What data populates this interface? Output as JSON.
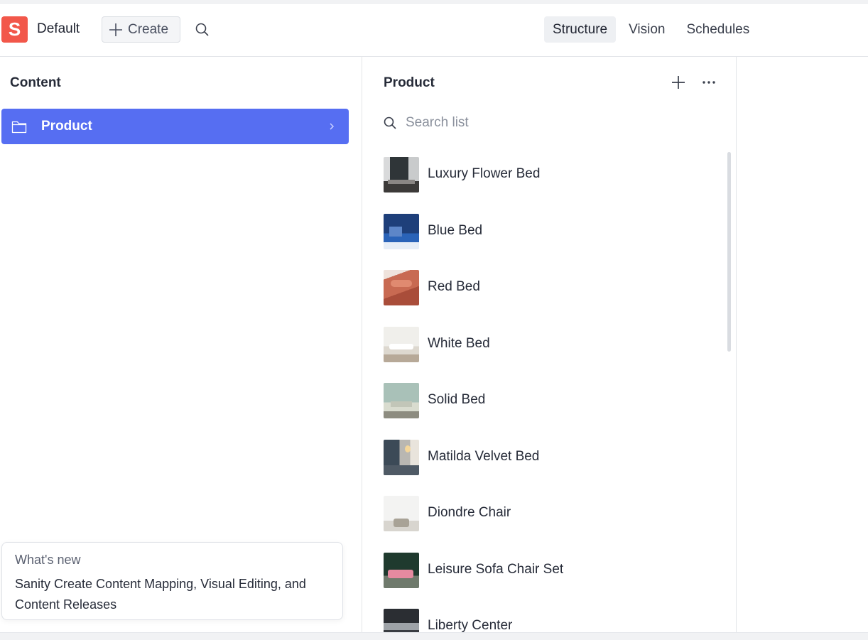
{
  "app": {
    "logo_letter": "S",
    "workspace": "Default",
    "create_label": "Create",
    "tools": [
      {
        "label": "Structure",
        "active": true
      },
      {
        "label": "Vision",
        "active": false
      },
      {
        "label": "Schedules",
        "active": false
      }
    ]
  },
  "content_pane": {
    "title": "Content",
    "items": [
      {
        "label": "Product",
        "icon": "folder-icon",
        "selected": true
      }
    ]
  },
  "whats_new": {
    "kicker": "What's new",
    "body": "Sanity Create Content Mapping, Visual Editing, and Content Releases"
  },
  "product_pane": {
    "title": "Product",
    "search_placeholder": "Search list",
    "documents": [
      {
        "name": "Luxury Flower Bed"
      },
      {
        "name": "Blue Bed"
      },
      {
        "name": "Red Bed"
      },
      {
        "name": "White Bed"
      },
      {
        "name": "Solid Bed"
      },
      {
        "name": "Matilda Velvet Bed"
      },
      {
        "name": "Diondre Chair"
      },
      {
        "name": "Leisure Sofa Chair Set"
      },
      {
        "name": "Liberty Center"
      }
    ]
  },
  "colors": {
    "brand": "#f2574a",
    "selected_item": "#566ef2"
  }
}
